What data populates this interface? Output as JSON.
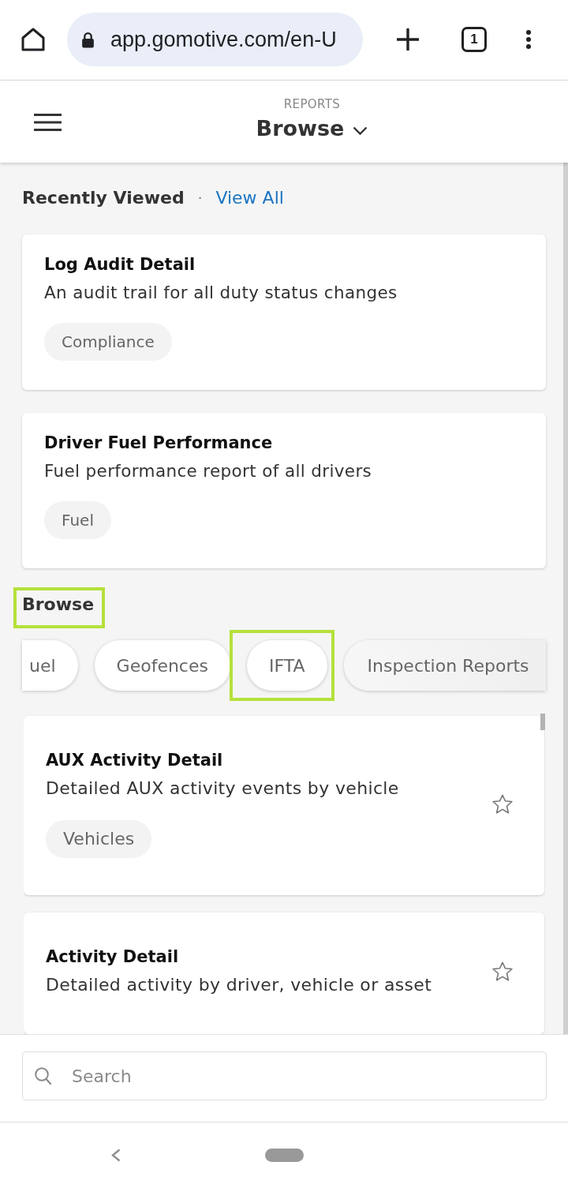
{
  "browser": {
    "url": "app.gomotive.com/en-U",
    "tab_count": "1"
  },
  "header": {
    "section": "REPORTS",
    "title": "Browse"
  },
  "recently_viewed": {
    "title": "Recently Viewed",
    "separator": "·",
    "link": "View All",
    "cards": [
      {
        "title": "Log Audit Detail",
        "description": "An audit trail for all duty status changes",
        "tag": "Compliance"
      },
      {
        "title": "Driver Fuel Performance",
        "description": "Fuel performance report of all drivers",
        "tag": "Fuel"
      }
    ]
  },
  "browse": {
    "title": "Browse",
    "highlighted": true,
    "categories": [
      {
        "label": "uel",
        "highlighted": false
      },
      {
        "label": "Geofences",
        "highlighted": false
      },
      {
        "label": "IFTA",
        "highlighted": true
      },
      {
        "label": "Inspection Reports",
        "highlighted": false
      }
    ],
    "reports": [
      {
        "title": "AUX Activity Detail",
        "description": "Detailed AUX activity events by vehicle",
        "tag": "Vehicles",
        "starred": false
      },
      {
        "title": "Activity Detail",
        "description": "Detailed activity by driver, vehicle or asset",
        "starred": false
      }
    ]
  },
  "search": {
    "placeholder": "Search"
  }
}
